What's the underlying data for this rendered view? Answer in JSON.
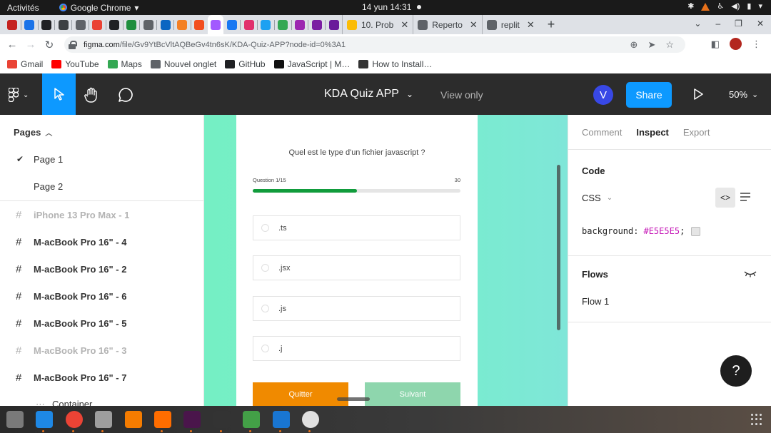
{
  "os": {
    "activities": "Activités",
    "app_menu": "Google Chrome",
    "clock": "14 yun  14:31"
  },
  "browser": {
    "tabs": [
      {
        "icon": "mail-icon",
        "color": "#c5221f"
      },
      {
        "icon": "calendar-icon",
        "color": "#1a73e8"
      },
      {
        "icon": "camera-icon",
        "color": "#202124"
      },
      {
        "icon": "image-icon",
        "color": "#3c4043"
      },
      {
        "icon": "globe-icon",
        "color": "#5f6368"
      },
      {
        "icon": "gmail-icon",
        "color": "#ea4335"
      },
      {
        "icon": "github-icon",
        "color": "#202124"
      },
      {
        "icon": "green-circle-icon",
        "color": "#1e8e3e"
      },
      {
        "icon": "globe-icon",
        "color": "#5f6368"
      },
      {
        "icon": "linkedin-icon",
        "color": "#0a66c2"
      },
      {
        "icon": "stack-icon",
        "color": "#f48024"
      },
      {
        "icon": "figma-icon",
        "color": "#f24e1e"
      },
      {
        "icon": "figma-icon",
        "color": "#a259ff"
      },
      {
        "icon": "facebook-icon",
        "color": "#1877f2"
      },
      {
        "icon": "instagram-icon",
        "color": "#e1306c"
      },
      {
        "icon": "twitter-icon",
        "color": "#1da1f2"
      },
      {
        "icon": "download-icon",
        "color": "#34a853"
      },
      {
        "icon": "b-icon",
        "color": "#9c27b0"
      },
      {
        "icon": "d-icon",
        "color": "#7b1fa2"
      },
      {
        "icon": "d-icon",
        "color": "#6a1b9a"
      }
    ],
    "wide_tabs": [
      {
        "label": "10. Prob",
        "color": "#fbbc05"
      },
      {
        "label": "Reperto",
        "color": "#5f6368"
      },
      {
        "label": "replit",
        "color": "#5f6368"
      }
    ],
    "url_host": "figma.com",
    "url_path": "/file/Gv9YtBcVltAQBeGv4tn6sK/KDA-Quiz-APP?node-id=0%3A1",
    "bookmarks": [
      {
        "label": "Gmail",
        "color": "#ea4335"
      },
      {
        "label": "YouTube",
        "color": "#ff0000"
      },
      {
        "label": "Maps",
        "color": "#34a853"
      },
      {
        "label": "Nouvel onglet",
        "color": "#5f6368"
      },
      {
        "label": "GitHub",
        "color": "#202124"
      },
      {
        "label": "JavaScript | M…",
        "color": "#111111"
      },
      {
        "label": "How to Install…",
        "color": "#333333"
      }
    ]
  },
  "figma": {
    "file_title": "KDA Quiz APP",
    "view_mode": "View only",
    "user_initial": "V",
    "share_label": "Share",
    "zoom": "50%",
    "pages_header": "Pages",
    "pages": [
      {
        "label": "Page 1",
        "active": true
      },
      {
        "label": "Page 2",
        "active": false
      }
    ],
    "frames": [
      {
        "label": "iPhone 13 Pro Max - 1",
        "dim": true
      },
      {
        "label": "M-acBook Pro 16\" - 4",
        "dim": false
      },
      {
        "label": "M-acBook Pro 16\" - 2",
        "dim": false
      },
      {
        "label": "M-acBook Pro 16\" - 6",
        "dim": false
      },
      {
        "label": "M-acBook Pro 16\" - 5",
        "dim": false
      },
      {
        "label": "M-acBook Pro 16\" - 3",
        "dim": true
      },
      {
        "label": "M-acBook Pro 16\" - 7",
        "dim": false
      }
    ],
    "container_label": "Container",
    "right_tabs": [
      "Comment",
      "Inspect",
      "Export"
    ],
    "code_header": "Code",
    "code_lang": "CSS",
    "code_property": "background:",
    "code_value": "#E5E5E5",
    "code_semicolon": ";",
    "flows_header": "Flows",
    "flow_item": "Flow 1",
    "help_label": "?"
  },
  "quiz": {
    "question": "Quel est le type d'un fichier javascript ?",
    "progress_label": "Question 1/15",
    "timer": "30",
    "progress_fraction": 0.5,
    "options": [
      ".ts",
      ".jsx",
      ".js",
      ".j"
    ],
    "quit_label": "Quitter",
    "next_label": "Suivant"
  },
  "dock": [
    {
      "icon": "files-icon",
      "color": "#7a7a7a"
    },
    {
      "icon": "vscode-icon",
      "color": "#1e88e5"
    },
    {
      "icon": "chrome-icon",
      "color": "#ea4335"
    },
    {
      "icon": "image-viewer-icon",
      "color": "#9e9e9e"
    },
    {
      "icon": "vlc-icon",
      "color": "#f57c00"
    },
    {
      "icon": "pen-icon",
      "color": "#ff6d00"
    },
    {
      "icon": "slack-icon",
      "color": "#4a154b"
    },
    {
      "icon": "terminal-icon",
      "color": "#333333"
    },
    {
      "icon": "calc-icon",
      "color": "#43a047"
    },
    {
      "icon": "writer-icon",
      "color": "#1976d2"
    },
    {
      "icon": "disc-icon",
      "color": "#e0e0e0"
    }
  ]
}
